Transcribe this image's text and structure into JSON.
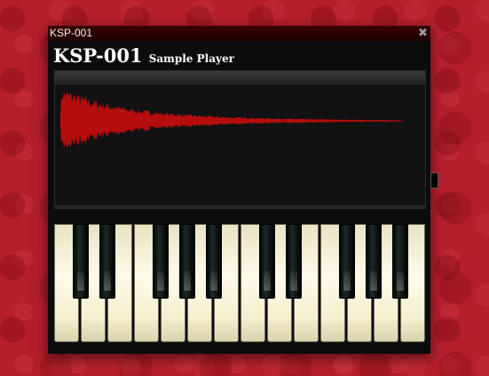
{
  "window": {
    "title": "KSP-001",
    "close_label": "✖"
  },
  "header": {
    "name": "KSP-001",
    "subtitle": "Sample Player"
  },
  "colors": {
    "background": "#b51f2c",
    "titlebar": "#2a0000",
    "waveform": "#b50d0d",
    "window": "#0c0c0c",
    "white_key": "#fffbe8",
    "black_key": "#0d1412"
  },
  "keyboard": {
    "white_key_count": 14,
    "black_key_pattern": [
      1,
      1,
      0,
      1,
      1,
      1,
      0,
      1,
      1,
      0,
      1,
      1,
      1
    ]
  },
  "icons": {
    "close": "close-icon"
  }
}
